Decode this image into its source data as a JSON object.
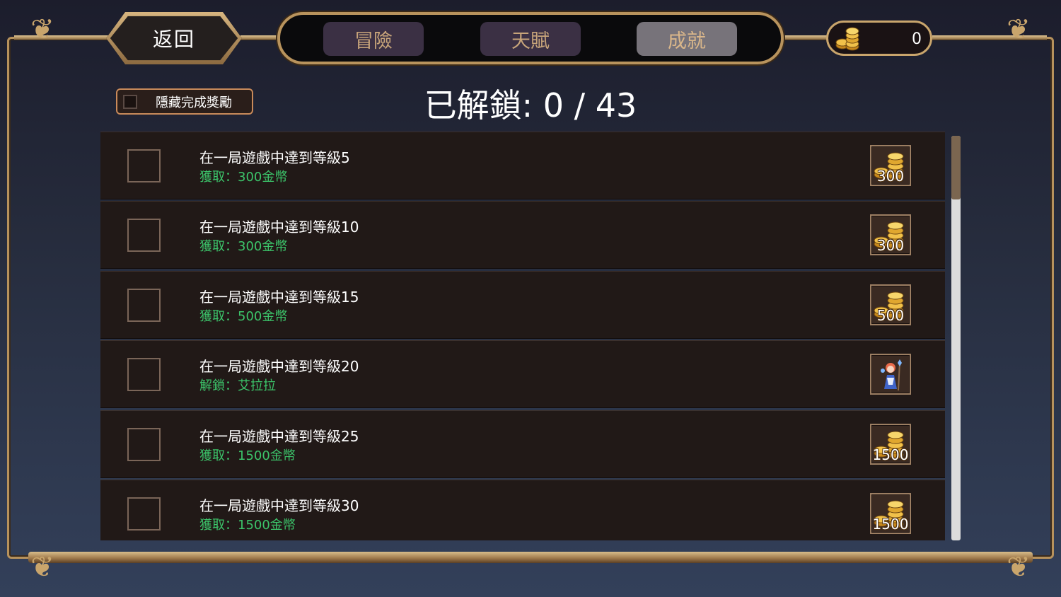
{
  "header": {
    "back_label": "返回",
    "tabs": [
      {
        "label": "冒險",
        "active": false
      },
      {
        "label": "天賦",
        "active": false
      },
      {
        "label": "成就",
        "active": true
      }
    ],
    "coins": "0",
    "coin_icon": "gold-coins-icon"
  },
  "toolbar": {
    "hide_completed_label": "隱藏完成獎勵",
    "hide_completed_checked": false
  },
  "summary": {
    "label": "已解鎖: 0 / 43"
  },
  "achievements": [
    {
      "title": "在一局遊戲中達到等級5",
      "reward": "獲取：300金幣",
      "reward_icon": "gold-coins-icon",
      "reward_amount": "300",
      "completed": false
    },
    {
      "title": "在一局遊戲中達到等級10",
      "reward": "獲取：300金幣",
      "reward_icon": "gold-coins-icon",
      "reward_amount": "300",
      "completed": false
    },
    {
      "title": "在一局遊戲中達到等級15",
      "reward": "獲取：500金幣",
      "reward_icon": "gold-coins-icon",
      "reward_amount": "500",
      "completed": false
    },
    {
      "title": "在一局遊戲中達到等級20",
      "reward": "解鎖：艾拉拉",
      "reward_icon": "character-portrait-icon",
      "reward_amount": "",
      "completed": false
    },
    {
      "title": "在一局遊戲中達到等級25",
      "reward": "獲取：1500金幣",
      "reward_icon": "gold-coins-icon",
      "reward_amount": "1500",
      "completed": false
    },
    {
      "title": "在一局遊戲中達到等級30",
      "reward": "獲取：1500金幣",
      "reward_icon": "gold-coins-icon",
      "reward_amount": "1500",
      "completed": false
    }
  ],
  "colors": {
    "accent_gold": "#b8935d",
    "reward_text": "#3cc46a",
    "active_tab": "#77737a",
    "inactive_tab": "#3b3044"
  }
}
